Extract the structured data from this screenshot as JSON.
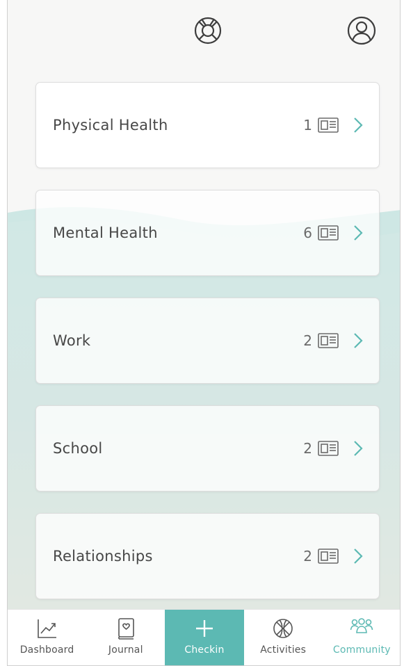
{
  "colors": {
    "accent": "#5cb9b3",
    "text": "#474747",
    "chevron": "#5cb9b3"
  },
  "header": {
    "left_icon": "lifebuoy-icon",
    "right_icon": "user-profile-icon"
  },
  "categories": [
    {
      "title": "Physical Health",
      "count": "1"
    },
    {
      "title": "Mental Health",
      "count": "6"
    },
    {
      "title": "Work",
      "count": "2"
    },
    {
      "title": "School",
      "count": "2"
    },
    {
      "title": "Relationships",
      "count": "2"
    }
  ],
  "nav": {
    "items": [
      {
        "label": "Dashboard",
        "icon": "trend-chart-icon"
      },
      {
        "label": "Journal",
        "icon": "journal-heart-icon"
      },
      {
        "label": "Checkin",
        "icon": "plus-icon"
      },
      {
        "label": "Activities",
        "icon": "basketball-icon"
      },
      {
        "label": "Community",
        "icon": "people-group-icon"
      }
    ],
    "active": "Community"
  }
}
